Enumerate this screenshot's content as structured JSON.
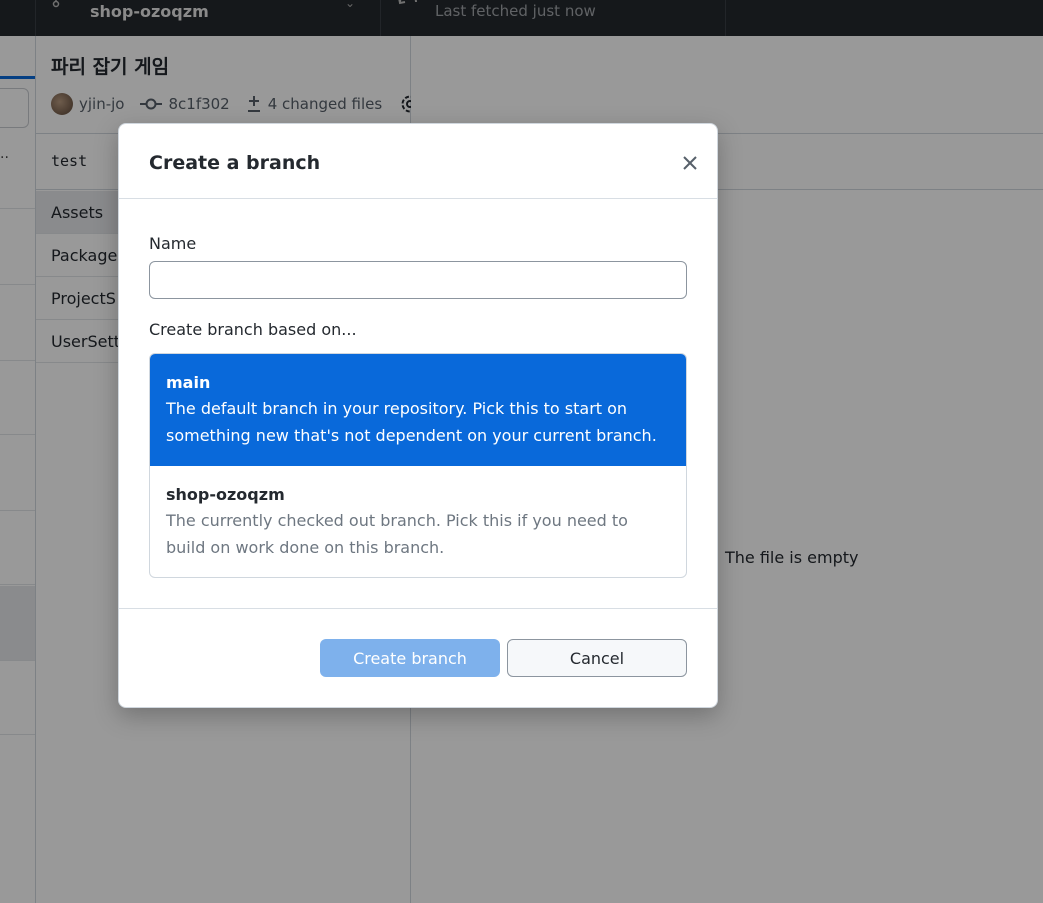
{
  "toolbar": {
    "branch_name": "shop-ozoqzm",
    "fetch_status": "Last fetched just now",
    "icons": [
      "git-branch-icon",
      "chevron-down-icon",
      "sync-icon"
    ]
  },
  "commit": {
    "title": "파리 잡기 게임",
    "author": "yjin-jo",
    "sha": "8c1f302",
    "changed_files": "4 changed files",
    "icons": [
      "avatar",
      "git-commit-icon",
      "diff-icon",
      "gear-icon",
      "caret-down-icon"
    ]
  },
  "sidebar": {
    "dots": "..",
    "test_label": "test",
    "files": [
      {
        "name": "Assets",
        "selected": true
      },
      {
        "name": "Package",
        "selected": false
      },
      {
        "name": "ProjectS",
        "selected": false
      },
      {
        "name": "UserSett",
        "selected": false
      }
    ]
  },
  "diff": {
    "empty_message": "The file is empty"
  },
  "dialog": {
    "title": "Create a branch",
    "name_label": "Name",
    "name_value": "",
    "based_on_label": "Create branch based on...",
    "options": [
      {
        "name": "main",
        "desc_line1": "The default branch in your repository. Pick this to start on",
        "desc_line2": "something new that's not dependent on your current branch.",
        "selected": true
      },
      {
        "name": "shop-ozoqzm",
        "desc_line1": "The currently checked out branch. Pick this if you need to",
        "desc_line2": "build on work done on this branch.",
        "selected": false
      }
    ],
    "create_button": "Create branch",
    "cancel_button": "Cancel",
    "create_button_enabled": false
  },
  "colors": {
    "accent": "#0969da",
    "toolbar_bg": "#24292e",
    "create_button_disabled": "#7eb1ec",
    "overlay": "rgba(0,0,0,0.4)"
  }
}
